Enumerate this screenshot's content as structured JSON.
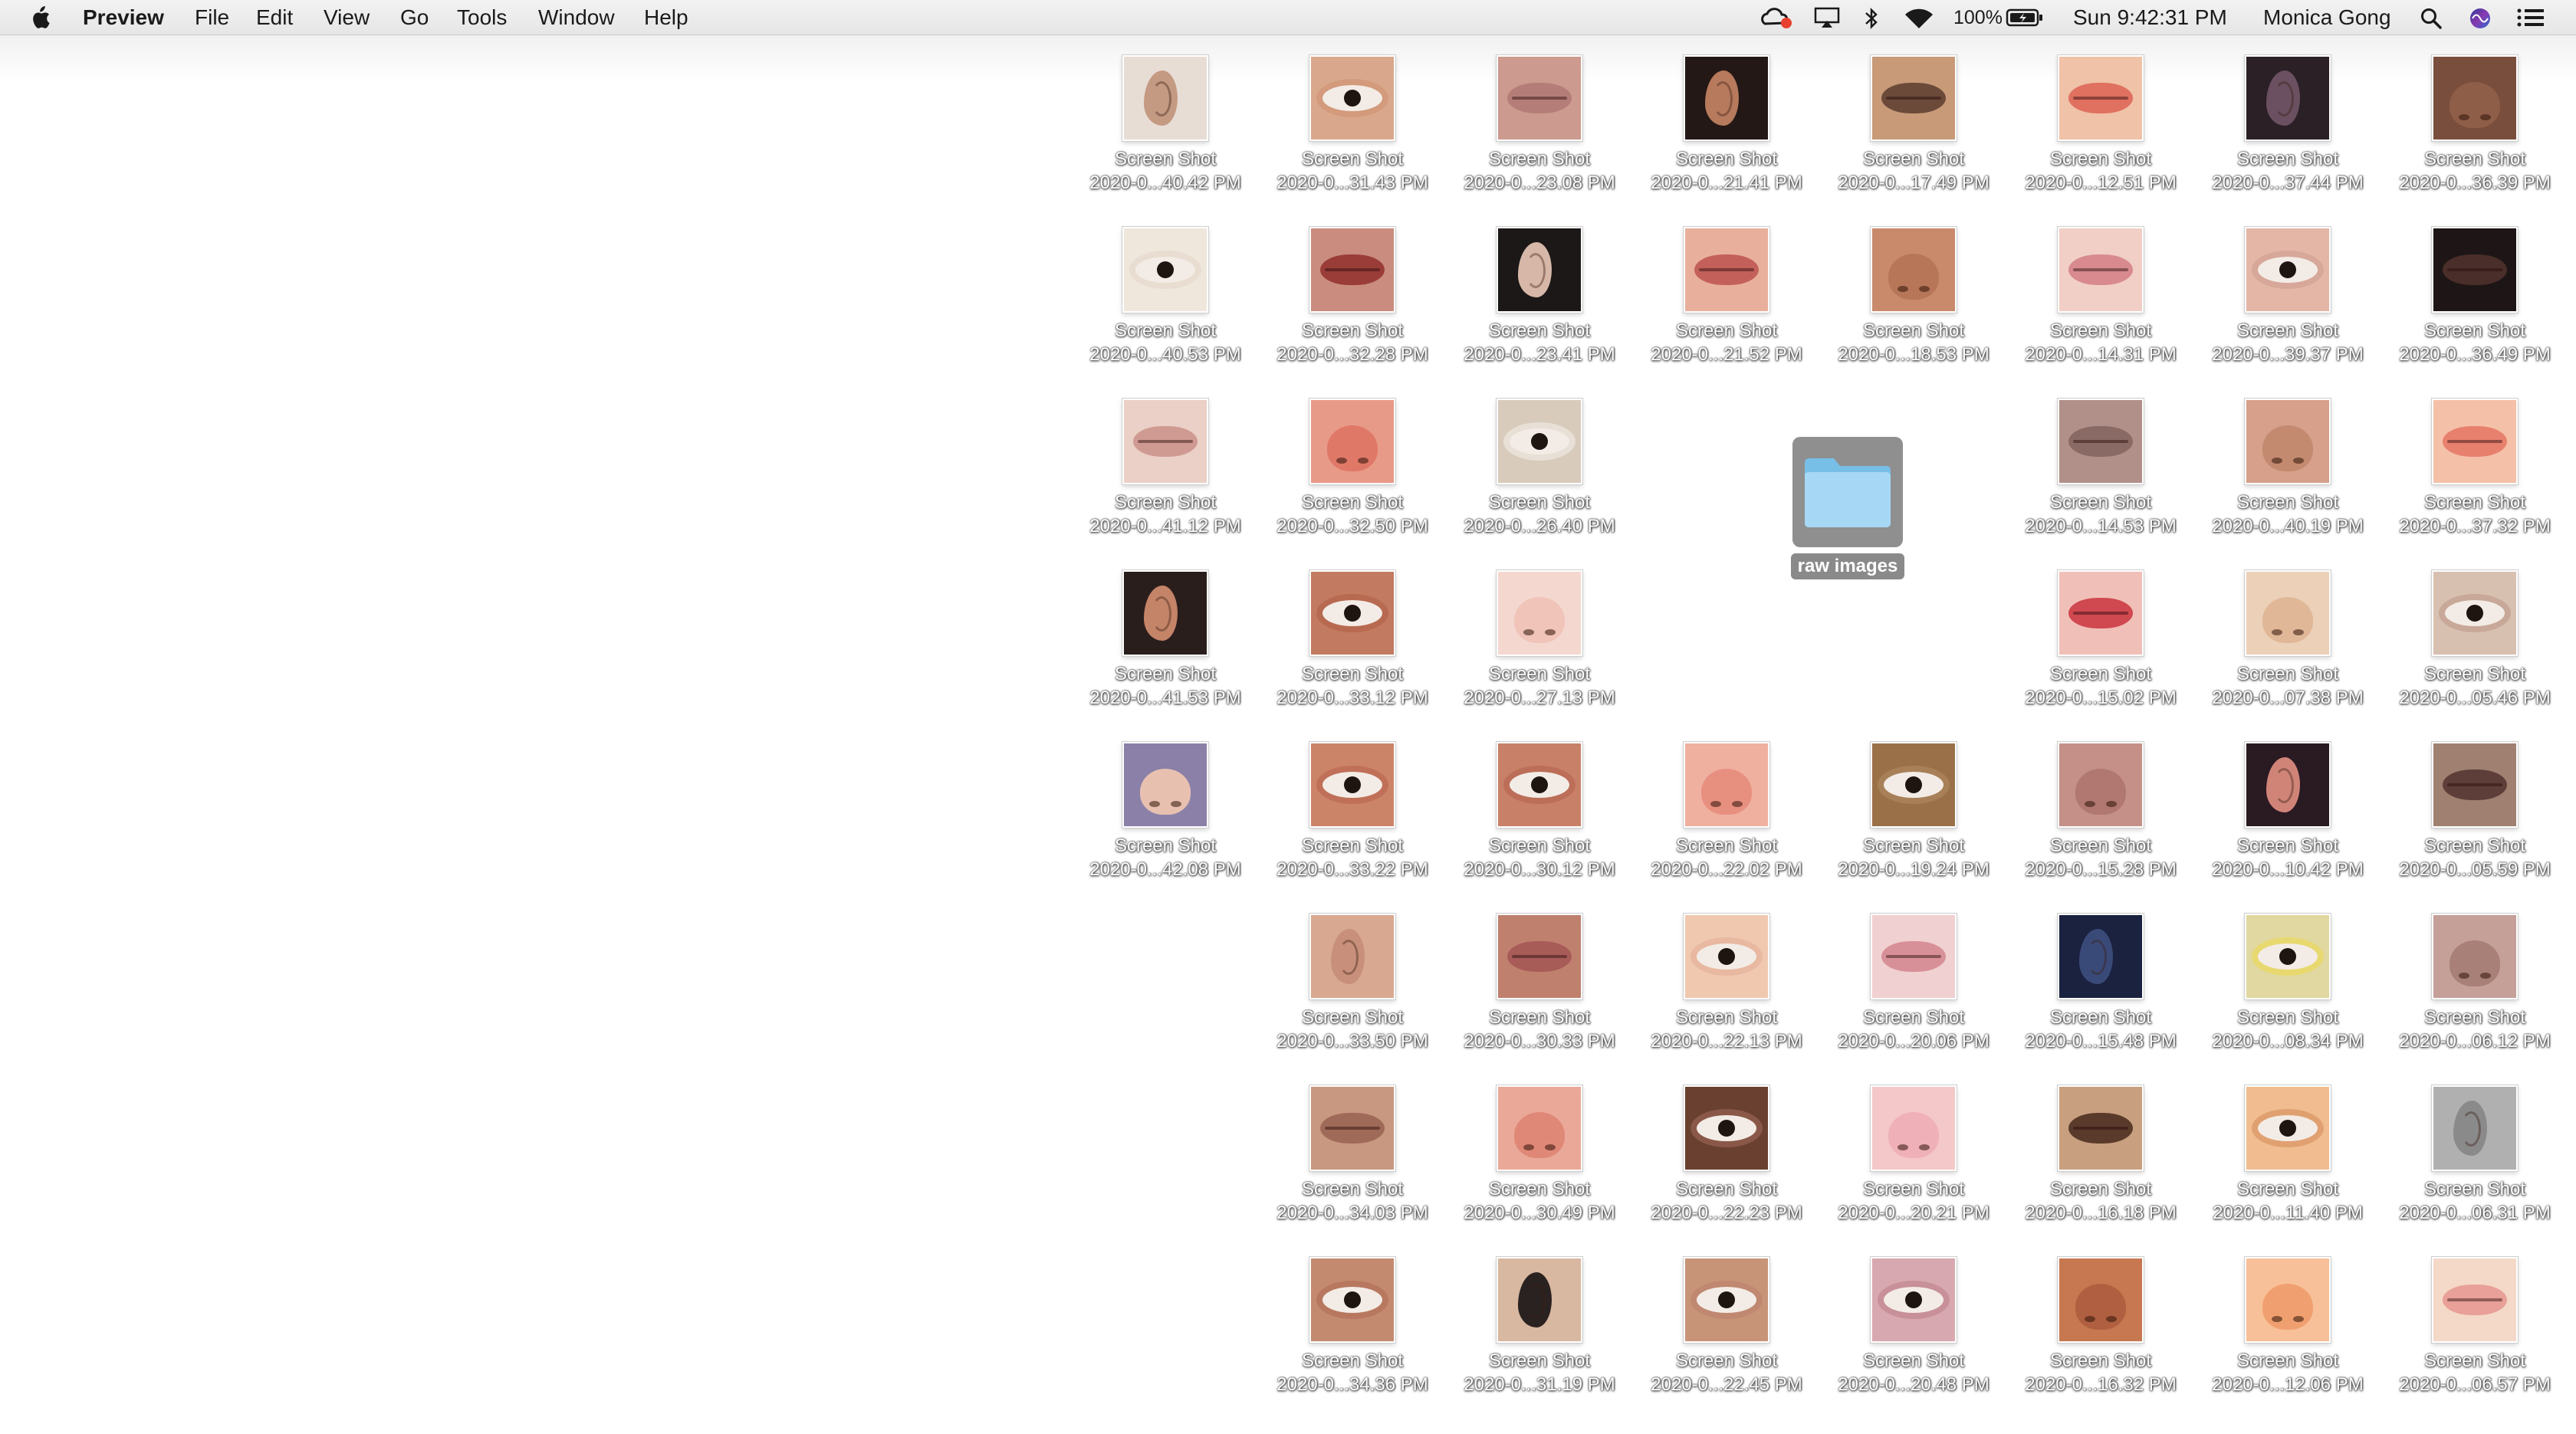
{
  "menubar": {
    "app_name": "Preview",
    "menus": [
      "File",
      "Edit",
      "View",
      "Go",
      "Tools",
      "Window",
      "Help"
    ],
    "status": {
      "battery": "100%",
      "clock": "Sun 9:42:31 PM",
      "user": "Monica Gong"
    },
    "icons": [
      "apple-icon",
      "creative-cloud-icon",
      "airplay-icon",
      "bluetooth-icon",
      "wifi-icon",
      "battery-icon",
      "spotlight-icon",
      "siri-icon",
      "notification-center-icon"
    ]
  },
  "desktop": {
    "file_label_line1": "Screen Shot",
    "folder": {
      "name": "raw images",
      "color": "#9fd6f5",
      "selected": true
    },
    "files": [
      {
        "row": 0,
        "col": 0,
        "time": "2020-0...40.42 PM",
        "kind": "ear",
        "tone": "#c49a82",
        "bg": "#e8ddd5"
      },
      {
        "row": 0,
        "col": 1,
        "time": "2020-0...31.43 PM",
        "kind": "eye",
        "tone": "#d39a7c",
        "bg": "#d9a88c"
      },
      {
        "row": 0,
        "col": 2,
        "time": "2020-0...23.08 PM",
        "kind": "lips",
        "tone": "#b57d78",
        "bg": "#cc9a8e"
      },
      {
        "row": 0,
        "col": 3,
        "time": "2020-0...21.41 PM",
        "kind": "ear",
        "tone": "#b77a5c",
        "bg": "#231816"
      },
      {
        "row": 0,
        "col": 4,
        "time": "2020-0...17.49 PM",
        "kind": "lips",
        "tone": "#6b4a3a",
        "bg": "#c89a78"
      },
      {
        "row": 0,
        "col": 5,
        "time": "2020-0...12.51 PM",
        "kind": "lips",
        "tone": "#e07060",
        "bg": "#f0c2a8"
      },
      {
        "row": 0,
        "col": 6,
        "time": "2020-0...37.44 PM",
        "kind": "ear",
        "tone": "#6a5060",
        "bg": "#2a2026"
      },
      {
        "row": 0,
        "col": 7,
        "time": "2020-0...36.39 PM",
        "kind": "nose",
        "tone": "#8f5e48",
        "bg": "#7a4e3c"
      },
      {
        "row": 1,
        "col": 0,
        "time": "2020-0...40.53 PM",
        "kind": "eye",
        "tone": "#e8ddd0",
        "bg": "#efe6dc"
      },
      {
        "row": 1,
        "col": 1,
        "time": "2020-0...32.28 PM",
        "kind": "lips",
        "tone": "#9a3c38",
        "bg": "#c98c7e"
      },
      {
        "row": 1,
        "col": 2,
        "time": "2020-0...23.41 PM",
        "kind": "ear",
        "tone": "#d7b8a8",
        "bg": "#1c1818"
      },
      {
        "row": 1,
        "col": 3,
        "time": "2020-0...21.52 PM",
        "kind": "lips",
        "tone": "#c4605a",
        "bg": "#e8b09c"
      },
      {
        "row": 1,
        "col": 4,
        "time": "2020-0...18.53 PM",
        "kind": "nose",
        "tone": "#b87658",
        "bg": "#c98a6c"
      },
      {
        "row": 1,
        "col": 5,
        "time": "2020-0...14.31 PM",
        "kind": "lips",
        "tone": "#d88a8e",
        "bg": "#f1cfc6"
      },
      {
        "row": 1,
        "col": 6,
        "time": "2020-0...39.37 PM",
        "kind": "eye",
        "tone": "#d7a89a",
        "bg": "#e3b6a6"
      },
      {
        "row": 1,
        "col": 7,
        "time": "2020-0...36.49 PM",
        "kind": "lips",
        "tone": "#4a2e2a",
        "bg": "#1e1616"
      },
      {
        "row": 2,
        "col": 0,
        "time": "2020-0...41.12 PM",
        "kind": "lips",
        "tone": "#cf9a92",
        "bg": "#ead0c6"
      },
      {
        "row": 2,
        "col": 1,
        "time": "2020-0...32.50 PM",
        "kind": "nose",
        "tone": "#e07868",
        "bg": "#e89a88"
      },
      {
        "row": 2,
        "col": 2,
        "time": "2020-0...26.40 PM",
        "kind": "eye",
        "tone": "#e8e0d6",
        "bg": "#d8cbbc"
      },
      {
        "row": 2,
        "col": 5,
        "time": "2020-0...14.53 PM",
        "kind": "lips",
        "tone": "#8a6a64",
        "bg": "#b09088"
      },
      {
        "row": 2,
        "col": 6,
        "time": "2020-0...40.19 PM",
        "kind": "nose",
        "tone": "#c48a70",
        "bg": "#d6a08a"
      },
      {
        "row": 2,
        "col": 7,
        "time": "2020-0...37.32 PM",
        "kind": "lips",
        "tone": "#e8806e",
        "bg": "#f4c0a8"
      },
      {
        "row": 3,
        "col": 0,
        "time": "2020-0...41.53 PM",
        "kind": "ear",
        "tone": "#c48468",
        "bg": "#2a1e1c"
      },
      {
        "row": 3,
        "col": 1,
        "time": "2020-0...33.12 PM",
        "kind": "eye",
        "tone": "#b86a50",
        "bg": "#c27a60"
      },
      {
        "row": 3,
        "col": 2,
        "time": "2020-0...27.13 PM",
        "kind": "nose",
        "tone": "#f0c4b8",
        "bg": "#f4d8d0"
      },
      {
        "row": 3,
        "col": 5,
        "time": "2020-0...15.02 PM",
        "kind": "lips",
        "tone": "#d04850",
        "bg": "#f0c0b8"
      },
      {
        "row": 3,
        "col": 6,
        "time": "2020-0...07.38 PM",
        "kind": "nose",
        "tone": "#e0b898",
        "bg": "#ecd0b8"
      },
      {
        "row": 3,
        "col": 7,
        "time": "2020-0...05.46 PM",
        "kind": "eye",
        "tone": "#c8a898",
        "bg": "#d8c0b0"
      },
      {
        "row": 4,
        "col": 0,
        "time": "2020-0...42.08 PM",
        "kind": "nose",
        "tone": "#e8c0b0",
        "bg": "#8a80a8"
      },
      {
        "row": 4,
        "col": 1,
        "time": "2020-0...33.22 PM",
        "kind": "eye",
        "tone": "#c07058",
        "bg": "#cc8468"
      },
      {
        "row": 4,
        "col": 2,
        "time": "2020-0...30.12 PM",
        "kind": "eye",
        "tone": "#bc6e58",
        "bg": "#c88068"
      },
      {
        "row": 4,
        "col": 3,
        "time": "2020-0...22.02 PM",
        "kind": "nose",
        "tone": "#e89080",
        "bg": "#f0b0a0"
      },
      {
        "row": 4,
        "col": 4,
        "time": "2020-0...19.24 PM",
        "kind": "eye",
        "tone": "#a88058",
        "bg": "#9a7048"
      },
      {
        "row": 4,
        "col": 5,
        "time": "2020-0...15.28 PM",
        "kind": "nose",
        "tone": "#b07870",
        "bg": "#c49088"
      },
      {
        "row": 4,
        "col": 6,
        "time": "2020-0...10.42 PM",
        "kind": "ear",
        "tone": "#d08478",
        "bg": "#2a1a22"
      },
      {
        "row": 4,
        "col": 7,
        "time": "2020-0...05.59 PM",
        "kind": "lips",
        "tone": "#5e3e38",
        "bg": "#a08070"
      },
      {
        "row": 5,
        "col": 1,
        "time": "2020-0...33.50 PM",
        "kind": "ear",
        "tone": "#c8907a",
        "bg": "#d8a890"
      },
      {
        "row": 5,
        "col": 2,
        "time": "2020-0...30.33 PM",
        "kind": "lips",
        "tone": "#a85c58",
        "bg": "#c0806e"
      },
      {
        "row": 5,
        "col": 3,
        "time": "2020-0...22.13 PM",
        "kind": "eye",
        "tone": "#e8b8a0",
        "bg": "#f0c8b0"
      },
      {
        "row": 5,
        "col": 4,
        "time": "2020-0...20.06 PM",
        "kind": "lips",
        "tone": "#d89098",
        "bg": "#f0d0d0"
      },
      {
        "row": 5,
        "col": 5,
        "time": "2020-0...15.48 PM",
        "kind": "ear",
        "tone": "#3a4a78",
        "bg": "#1a2240"
      },
      {
        "row": 5,
        "col": 6,
        "time": "2020-0...08.34 PM",
        "kind": "eye",
        "tone": "#e8d870",
        "bg": "#e0d8a0"
      },
      {
        "row": 5,
        "col": 7,
        "time": "2020-0...06.12 PM",
        "kind": "nose",
        "tone": "#a88078",
        "bg": "#c4a098"
      },
      {
        "row": 6,
        "col": 1,
        "time": "2020-0...34.03 PM",
        "kind": "lips",
        "tone": "#a06a58",
        "bg": "#c89880"
      },
      {
        "row": 6,
        "col": 2,
        "time": "2020-0...30.49 PM",
        "kind": "nose",
        "tone": "#e08878",
        "bg": "#eaa898"
      },
      {
        "row": 6,
        "col": 3,
        "time": "2020-0...22.23 PM",
        "kind": "eye",
        "tone": "#8a5848",
        "bg": "#6a4030"
      },
      {
        "row": 6,
        "col": 4,
        "time": "2020-0...20.21 PM",
        "kind": "nose",
        "tone": "#f0b0b8",
        "bg": "#f4c8c8"
      },
      {
        "row": 6,
        "col": 5,
        "time": "2020-0...16.18 PM",
        "kind": "lips",
        "tone": "#5a3a2a",
        "bg": "#c8a080"
      },
      {
        "row": 6,
        "col": 6,
        "time": "2020-0...11.40 PM",
        "kind": "eye",
        "tone": "#e0a070",
        "bg": "#f0bc90"
      },
      {
        "row": 6,
        "col": 7,
        "time": "2020-0...06.31 PM",
        "kind": "ear",
        "tone": "#8a8a8a",
        "bg": "#b0b0b0"
      },
      {
        "row": 7,
        "col": 1,
        "time": "2020-0...34.36 PM",
        "kind": "eye",
        "tone": "#b87860",
        "bg": "#c48a70"
      },
      {
        "row": 7,
        "col": 2,
        "time": "2020-0...31.19 PM",
        "kind": "ear",
        "tone": "#2a2220",
        "bg": "#d8b8a0"
      },
      {
        "row": 7,
        "col": 3,
        "time": "2020-0...22.45 PM",
        "kind": "eye",
        "tone": "#c08870",
        "bg": "#c89478"
      },
      {
        "row": 7,
        "col": 4,
        "time": "2020-0...20.48 PM",
        "kind": "eye",
        "tone": "#c89098",
        "bg": "#d8a8b0"
      },
      {
        "row": 7,
        "col": 5,
        "time": "2020-0...16.32 PM",
        "kind": "nose",
        "tone": "#b06040",
        "bg": "#c87850"
      },
      {
        "row": 7,
        "col": 6,
        "time": "2020-0...12.06 PM",
        "kind": "nose",
        "tone": "#f0a070",
        "bg": "#f8c098"
      },
      {
        "row": 7,
        "col": 7,
        "time": "2020-0...06.57 PM",
        "kind": "lips",
        "tone": "#e8a098",
        "bg": "#f4d8c8"
      }
    ]
  }
}
